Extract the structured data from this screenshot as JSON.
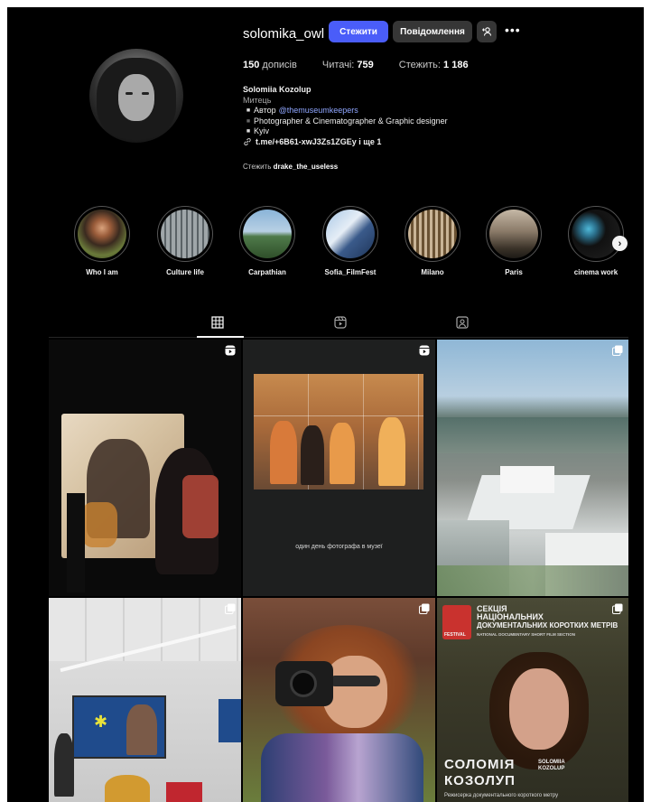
{
  "profile": {
    "username": "solomika_owl",
    "follow_label": "Стежити",
    "message_label": "Повідомлення",
    "add_user_icon": "⁺ᴬ",
    "more_icon": "•••"
  },
  "stats": {
    "posts_count": "150",
    "posts_label": "дописів",
    "followers_label": "Читачі:",
    "followers_count": "759",
    "following_label": "Стежить:",
    "following_count": "1 186"
  },
  "bio": {
    "name": "Solomiia Kozolup",
    "category": "Митець",
    "line1_prefix": "Автор",
    "line1_tag": "@themuseumkeepers",
    "line2": "Photographer & Cinematographer & Graphic designer",
    "line3": "Kyiv",
    "link_text": "t.me/+6B61-xwJ3Zs1ZGEy і ще 1",
    "followed_by_prefix": "Стежить",
    "followed_by_user": "drake_the_useless"
  },
  "highlights": [
    {
      "label": "Who I am"
    },
    {
      "label": "Culture life"
    },
    {
      "label": "Carpathian"
    },
    {
      "label": "Sofia_FilmFest"
    },
    {
      "label": "Milano"
    },
    {
      "label": "Paris"
    },
    {
      "label": "cinema work"
    }
  ],
  "highlights_next_icon": "›",
  "tabs": [
    "grid-icon",
    "reels-icon",
    "tagged-icon"
  ],
  "posts": {
    "caption_2": "один день фотографа в музеї",
    "poster_t6_line1": "СЕКЦІЯ",
    "poster_t6_line2": "НАЦІОНАЛЬНИХ",
    "poster_t6_line3": "ДОКУМЕНТАЛЬНИХ КОРОТКИХ МЕТРІВ",
    "poster_t6_sub": "NATIONAL DOCUMENTARY SHORT FILM SECTION",
    "poster_t6_name1": "СОЛОМІЯ",
    "poster_t6_name2": "КОЗОЛУП",
    "poster_t6_small1": "SOLOMIIA",
    "poster_t6_small2": "KOZOLUP",
    "poster_t6_footer": "Режисерка документального короткого метру",
    "poster_t6_fest": "FESTIVAL"
  },
  "colors": {
    "accent": "#4a5df9",
    "background": "#000000",
    "link": "#8fa6ff"
  }
}
